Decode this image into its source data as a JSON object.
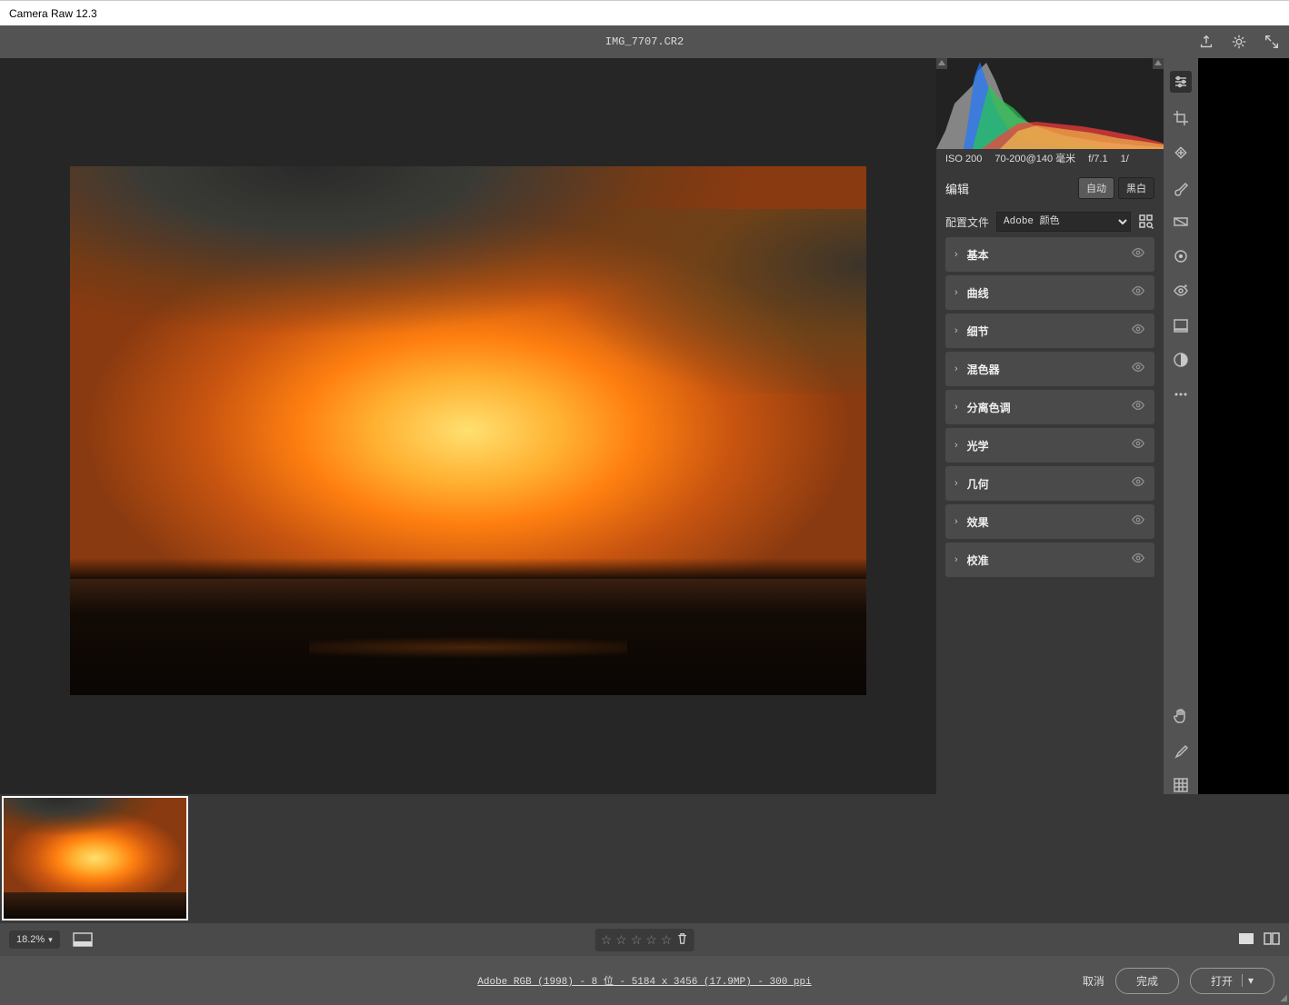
{
  "app_title": "Camera Raw 12.3",
  "filename": "IMG_7707.CR2",
  "metadata": {
    "iso": "ISO 200",
    "lens": "70-200@140 毫米",
    "aperture": "f/7.1",
    "shutter": "1/"
  },
  "edit_header": {
    "title": "编辑",
    "auto": "自动",
    "bw": "黑白"
  },
  "profile": {
    "label": "配置文件",
    "selected": "Adobe 颜色"
  },
  "panels": [
    "基本",
    "曲线",
    "细节",
    "混色器",
    "分离色调",
    "光学",
    "几何",
    "效果",
    "校准"
  ],
  "zoom": "18.2%",
  "footer_info": "Adobe RGB (1998) - 8 位 - 5184 x 3456 (17.9MP) - 300 ppi",
  "buttons": {
    "cancel": "取消",
    "done": "完成",
    "open": "打开"
  }
}
